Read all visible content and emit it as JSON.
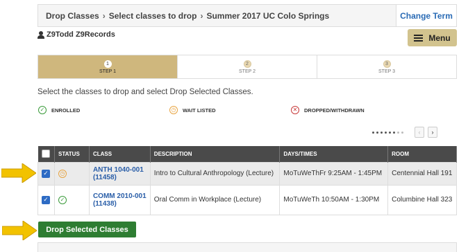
{
  "breadcrumb": {
    "items": [
      "Drop Classes",
      "Select classes to drop",
      "Summer 2017 UC Colo Springs"
    ],
    "separator": "›",
    "change_term_label": "Change Term"
  },
  "user": {
    "name": "Z9Todd Z9Records",
    "icon": "user-icon"
  },
  "menu": {
    "label": "Menu",
    "icon": "hamburger-icon"
  },
  "steps": [
    {
      "number": "1",
      "label": "STEP 1",
      "active": true
    },
    {
      "number": "2",
      "label": "STEP 2",
      "active": false
    },
    {
      "number": "3",
      "label": "STEP 3",
      "active": false
    }
  ],
  "instructions": "Select the classes to drop and select Drop Selected Classes.",
  "legend": [
    {
      "label": "ENROLLED",
      "icon": "check-circle-icon",
      "color": "#3a9b3a"
    },
    {
      "label": "WAIT LISTED",
      "icon": "clock-circle-icon",
      "color": "#e8a441"
    },
    {
      "label": "DROPPED/WITHDRAWN",
      "icon": "x-circle-icon",
      "color": "#c83a3a"
    }
  ],
  "pager": {
    "total_dots": 9,
    "active_dots": 6,
    "prev_icon": "chevron-left-icon",
    "next_icon": "chevron-right-icon"
  },
  "table": {
    "headers": [
      "",
      "STATUS",
      "CLASS",
      "DESCRIPTION",
      "DAYS/TIMES",
      "ROOM"
    ],
    "rows": [
      {
        "checked": true,
        "status": "wait-listed",
        "class_line1": "ANTH 1040-001",
        "class_line2": "(11458)",
        "description": "Intro to Cultural Anthropology (Lecture)",
        "days_times": "MoTuWeThFr 9:25AM - 1:45PM",
        "room": "Centennial Hall 191"
      },
      {
        "checked": true,
        "status": "enrolled",
        "class_line1": "COMM 2010-001",
        "class_line2": "(11438)",
        "description": "Oral Comm in Workplace (Lecture)",
        "days_times": "MoTuWeTh 10:50AM - 1:30PM",
        "room": "Columbine Hall 323"
      }
    ]
  },
  "drop_button_label": "Drop Selected Classes",
  "colors": {
    "gold": "#cfb77d",
    "menu_gold": "#d2c38e",
    "link_blue": "#2a6bb5",
    "drop_green": "#2e7d32",
    "header_dark": "#4a4a4a",
    "arrow_yellow": "#f2c200"
  }
}
